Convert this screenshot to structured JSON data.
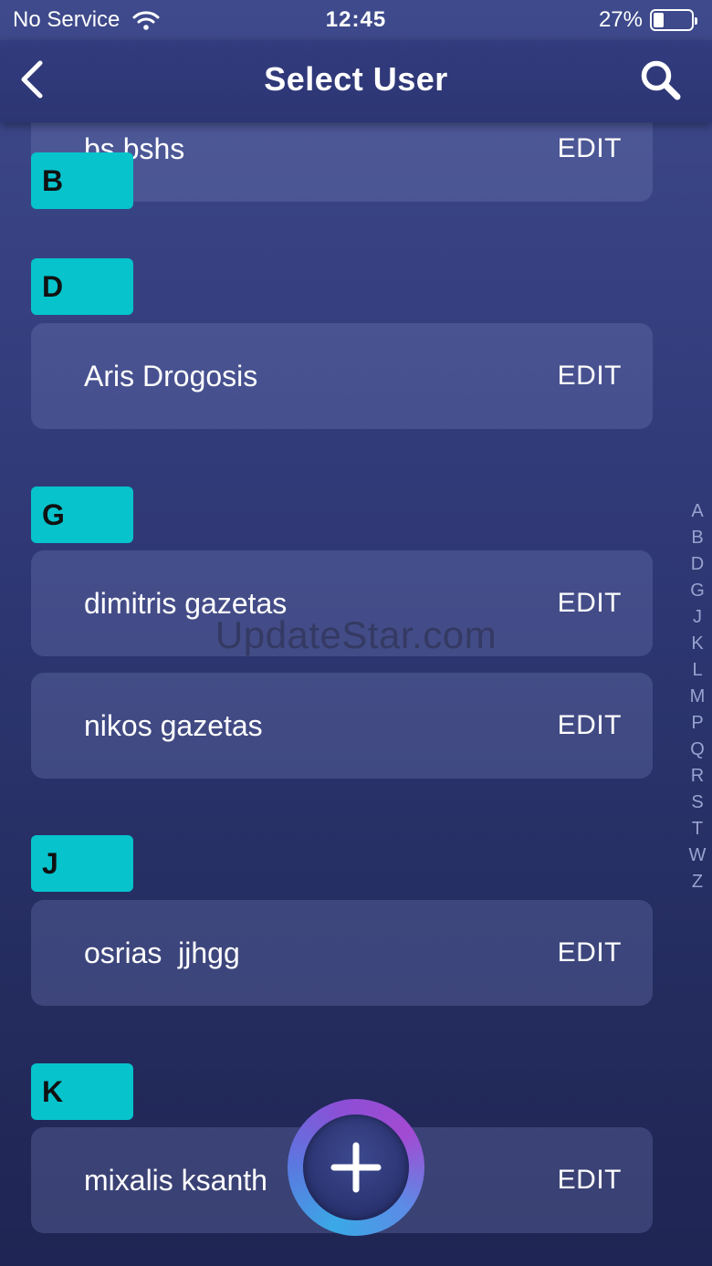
{
  "status_bar": {
    "carrier": "No Service",
    "time": "12:45",
    "battery_percent": "27%",
    "battery_level": 0.27
  },
  "nav": {
    "title": "Select User",
    "back_icon": "chevron-left-icon",
    "search_icon": "search-icon"
  },
  "sections": [
    {
      "letter": "B",
      "users": [
        {
          "name": "bs bshs",
          "action": "EDIT"
        }
      ]
    },
    {
      "letter": "D",
      "users": [
        {
          "name": "Aris Drogosis",
          "action": "EDIT"
        }
      ]
    },
    {
      "letter": "G",
      "users": [
        {
          "name": "dimitris gazetas",
          "action": "EDIT"
        },
        {
          "name": "nikos gazetas",
          "action": "EDIT"
        }
      ]
    },
    {
      "letter": "J",
      "users": [
        {
          "name": "osrias  jjhgg",
          "action": "EDIT"
        }
      ]
    },
    {
      "letter": "K",
      "users": [
        {
          "name": "mixalis ksanth",
          "action": "EDIT"
        }
      ]
    }
  ],
  "index_letters": [
    "A",
    "B",
    "D",
    "G",
    "J",
    "K",
    "L",
    "M",
    "P",
    "Q",
    "R",
    "S",
    "T",
    "W",
    "Z"
  ],
  "watermark": "UpdateStar.com",
  "fab": {
    "icon": "plus-icon"
  },
  "colors": {
    "section_header": "#06c3cc",
    "background_top": "#3e4a8c",
    "background_bottom": "#1f2553"
  }
}
